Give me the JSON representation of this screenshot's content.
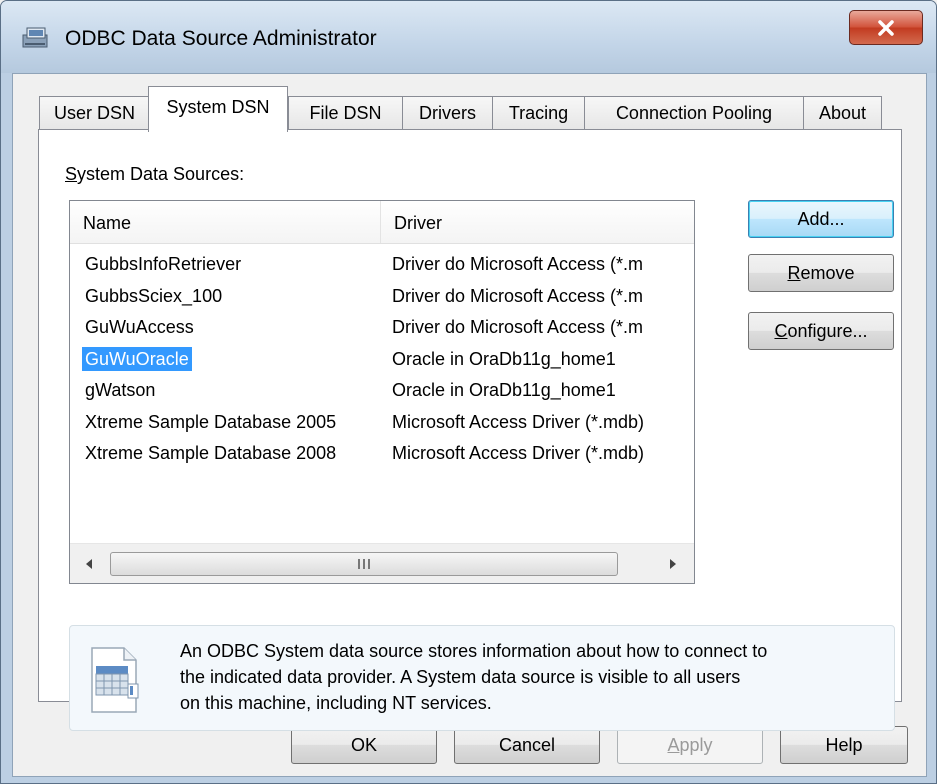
{
  "window": {
    "title": "ODBC Data Source Administrator",
    "close_glyph": "X"
  },
  "tabs": [
    {
      "label": "User DSN",
      "active": false
    },
    {
      "label": "System DSN",
      "active": true
    },
    {
      "label": "File DSN",
      "active": false
    },
    {
      "label": "Drivers",
      "active": false
    },
    {
      "label": "Tracing",
      "active": false
    },
    {
      "label": "Connection Pooling",
      "active": false
    },
    {
      "label": "About",
      "active": false
    }
  ],
  "system_dsn": {
    "group_label_mnemonic": "S",
    "group_label_rest": "ystem Data Sources:",
    "columns": {
      "name": "Name",
      "driver": "Driver"
    },
    "rows": [
      {
        "name": "GubbsInfoRetriever",
        "driver": "Driver do Microsoft Access (*.m",
        "selected": false
      },
      {
        "name": "GubbsSciex_100",
        "driver": "Driver do Microsoft Access (*.m",
        "selected": false
      },
      {
        "name": "GuWuAccess",
        "driver": "Driver do Microsoft Access (*.m",
        "selected": false
      },
      {
        "name": "GuWuOracle",
        "driver": "Oracle in OraDb11g_home1",
        "selected": true
      },
      {
        "name": "gWatson",
        "driver": "Oracle in OraDb11g_home1",
        "selected": false
      },
      {
        "name": "Xtreme Sample Database 2005",
        "driver": "Microsoft Access Driver (*.mdb)",
        "selected": false
      },
      {
        "name": "Xtreme Sample Database 2008",
        "driver": "Microsoft Access Driver (*.mdb)",
        "selected": false
      }
    ],
    "buttons": {
      "add": "Add...",
      "remove_mnemonic": "R",
      "remove_rest": "emove",
      "configure_mnemonic": "C",
      "configure_rest": "onfigure..."
    },
    "info_lines": [
      "An ODBC System data source stores information about how to connect to",
      "the indicated data provider.   A System data source is visible to all users",
      "on this machine, including NT services."
    ]
  },
  "footer": {
    "ok": "OK",
    "cancel": "Cancel",
    "apply_mnemonic": "A",
    "apply_rest": "pply",
    "help": "Help"
  },
  "colors": {
    "selection": "#3399ff",
    "close_button": "#c23b21",
    "default_button_border": "#3c7fb1"
  },
  "icons": {
    "app": "odbc-app-icon",
    "close": "close-icon",
    "info": "database-document-icon",
    "scroll_left": "scroll-left-arrow-icon",
    "scroll_right": "scroll-right-arrow-icon"
  }
}
